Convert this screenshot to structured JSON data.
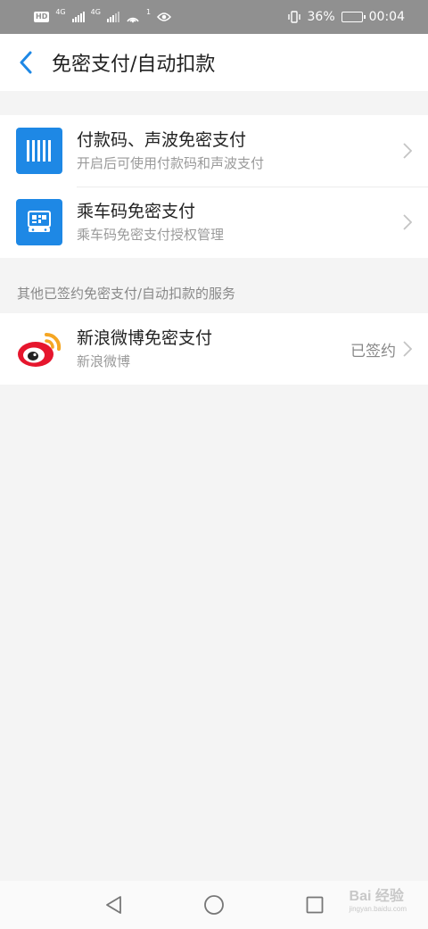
{
  "status_bar": {
    "left_chip": "HD",
    "network_label_1": "4G",
    "network_label_2": "4G",
    "hotspot_count": "1",
    "battery_percent": "36%",
    "battery_level": 0.36,
    "time": "00:04"
  },
  "header": {
    "title": "免密支付/自动扣款"
  },
  "group1": {
    "items": [
      {
        "title": "付款码、声波免密支付",
        "subtitle": "开启后可使用付款码和声波支付",
        "icon": "barcode-icon"
      },
      {
        "title": "乘车码免密支付",
        "subtitle": "乘车码免密支付授权管理",
        "icon": "bus-code-icon"
      }
    ]
  },
  "section": {
    "label": "其他已签约免密支付/自动扣款的服务"
  },
  "group2": {
    "items": [
      {
        "title": "新浪微博免密支付",
        "subtitle": "新浪微博",
        "status": "已签约",
        "icon": "weibo-icon"
      }
    ]
  },
  "watermark": {
    "text": "Bai 经验",
    "sub": "jingyan.baidu.com"
  },
  "colors": {
    "accent": "#1e88e5",
    "status_bar": "#909090",
    "background": "#f4f4f4"
  }
}
